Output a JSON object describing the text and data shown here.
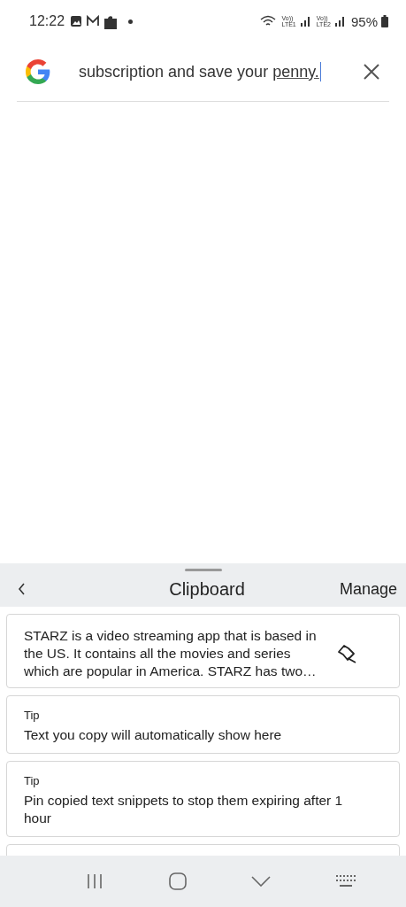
{
  "status_bar": {
    "time": "12:22",
    "sims": [
      {
        "volte": "Vo))",
        "label": "LTE1"
      },
      {
        "volte": "Vo))",
        "label": "LTE2"
      }
    ],
    "battery": "95%"
  },
  "search": {
    "value": "subscription and save your ",
    "composing": "penny."
  },
  "clipboard": {
    "title": "Clipboard",
    "action": "Manage",
    "items": [
      {
        "kind": "clip",
        "text": "STARZ is a video streaming app that is based in the US. It contains all the movies and series which are popular in America. STARZ has two…"
      },
      {
        "kind": "tip",
        "label": "Tip",
        "text": "Text you copy will automatically show here"
      },
      {
        "kind": "tip",
        "label": "Tip",
        "text": "Pin copied text snippets to stop them expiring after 1 hour"
      },
      {
        "kind": "partial"
      }
    ]
  }
}
